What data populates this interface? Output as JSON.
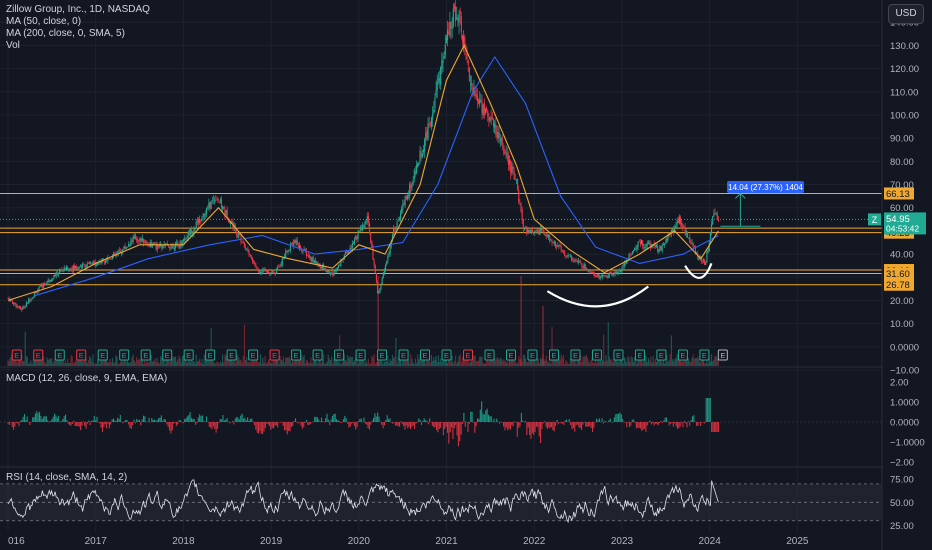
{
  "header": {
    "title": "Zillow Group, Inc., 1D, NASDAQ",
    "indicators": [
      "MA (50, close, 0)",
      "MA (200, close, 0, SMA, 5)",
      "Vol"
    ],
    "currency": "USD"
  },
  "chart_data": [
    {
      "type": "candlestick",
      "title": "Zillow Group, Inc., 1D, NASDAQ",
      "y_ticks": [
        "140.00",
        "130.00",
        "120.00",
        "110.00",
        "100.00",
        "90.00",
        "80.00",
        "70.00",
        "60.00",
        "50.00",
        "40.00",
        "30.00",
        "20.00",
        "10.00",
        "0.0000",
        "−10.00"
      ],
      "y_range": [
        -10,
        147
      ],
      "x_ticks": [
        "016",
        "2017",
        "2018",
        "2019",
        "2020",
        "2021",
        "2022",
        "2023",
        "2024",
        "2025"
      ],
      "x_range": [
        2016.0,
        2025.6
      ],
      "price_path": [
        {
          "x": 2016.0,
          "y": 21
        },
        {
          "x": 2016.15,
          "y": 16
        },
        {
          "x": 2016.35,
          "y": 25
        },
        {
          "x": 2016.6,
          "y": 33
        },
        {
          "x": 2016.85,
          "y": 35
        },
        {
          "x": 2017.0,
          "y": 36
        },
        {
          "x": 2017.25,
          "y": 40
        },
        {
          "x": 2017.45,
          "y": 47
        },
        {
          "x": 2017.7,
          "y": 43
        },
        {
          "x": 2017.95,
          "y": 44
        },
        {
          "x": 2018.15,
          "y": 53
        },
        {
          "x": 2018.37,
          "y": 65
        },
        {
          "x": 2018.6,
          "y": 50
        },
        {
          "x": 2018.85,
          "y": 33
        },
        {
          "x": 2019.05,
          "y": 32
        },
        {
          "x": 2019.25,
          "y": 46
        },
        {
          "x": 2019.45,
          "y": 38
        },
        {
          "x": 2019.7,
          "y": 31
        },
        {
          "x": 2019.95,
          "y": 46
        },
        {
          "x": 2020.1,
          "y": 55
        },
        {
          "x": 2020.22,
          "y": 22
        },
        {
          "x": 2020.4,
          "y": 50
        },
        {
          "x": 2020.6,
          "y": 70
        },
        {
          "x": 2020.8,
          "y": 95
        },
        {
          "x": 2021.0,
          "y": 132
        },
        {
          "x": 2021.12,
          "y": 147
        },
        {
          "x": 2021.3,
          "y": 110
        },
        {
          "x": 2021.55,
          "y": 95
        },
        {
          "x": 2021.8,
          "y": 70
        },
        {
          "x": 2021.88,
          "y": 50
        },
        {
          "x": 2022.1,
          "y": 50
        },
        {
          "x": 2022.35,
          "y": 40
        },
        {
          "x": 2022.6,
          "y": 34
        },
        {
          "x": 2022.75,
          "y": 30
        },
        {
          "x": 2022.95,
          "y": 32
        },
        {
          "x": 2023.2,
          "y": 45
        },
        {
          "x": 2023.45,
          "y": 42
        },
        {
          "x": 2023.65,
          "y": 55
        },
        {
          "x": 2023.85,
          "y": 40
        },
        {
          "x": 2023.95,
          "y": 36
        },
        {
          "x": 2024.05,
          "y": 58
        },
        {
          "x": 2024.1,
          "y": 55
        }
      ],
      "ma50_path": [
        {
          "x": 2016.0,
          "y": 20
        },
        {
          "x": 2016.5,
          "y": 26
        },
        {
          "x": 2017.0,
          "y": 36
        },
        {
          "x": 2017.5,
          "y": 44
        },
        {
          "x": 2018.0,
          "y": 44
        },
        {
          "x": 2018.4,
          "y": 60
        },
        {
          "x": 2018.8,
          "y": 42
        },
        {
          "x": 2019.2,
          "y": 38
        },
        {
          "x": 2019.7,
          "y": 34
        },
        {
          "x": 2020.0,
          "y": 44
        },
        {
          "x": 2020.3,
          "y": 40
        },
        {
          "x": 2020.7,
          "y": 70
        },
        {
          "x": 2021.0,
          "y": 115
        },
        {
          "x": 2021.2,
          "y": 130
        },
        {
          "x": 2021.5,
          "y": 105
        },
        {
          "x": 2021.8,
          "y": 78
        },
        {
          "x": 2022.0,
          "y": 55
        },
        {
          "x": 2022.4,
          "y": 42
        },
        {
          "x": 2022.8,
          "y": 32
        },
        {
          "x": 2023.2,
          "y": 40
        },
        {
          "x": 2023.6,
          "y": 50
        },
        {
          "x": 2023.9,
          "y": 38
        },
        {
          "x": 2024.1,
          "y": 50
        }
      ],
      "ma200_path": [
        {
          "x": 2016.3,
          "y": 22
        },
        {
          "x": 2017.0,
          "y": 30
        },
        {
          "x": 2017.6,
          "y": 38
        },
        {
          "x": 2018.3,
          "y": 44
        },
        {
          "x": 2018.9,
          "y": 48
        },
        {
          "x": 2019.5,
          "y": 40
        },
        {
          "x": 2020.0,
          "y": 42
        },
        {
          "x": 2020.5,
          "y": 45
        },
        {
          "x": 2020.9,
          "y": 70
        },
        {
          "x": 2021.3,
          "y": 110
        },
        {
          "x": 2021.55,
          "y": 125
        },
        {
          "x": 2021.9,
          "y": 105
        },
        {
          "x": 2022.3,
          "y": 65
        },
        {
          "x": 2022.7,
          "y": 43
        },
        {
          "x": 2023.2,
          "y": 36
        },
        {
          "x": 2023.7,
          "y": 40
        },
        {
          "x": 2024.1,
          "y": 48
        }
      ],
      "horizontal_levels": [
        {
          "value": 66.13,
          "label": "66.13",
          "color": "#f0a830"
        },
        {
          "value": 51.18,
          "label": "51.18",
          "color": "#f0a830"
        },
        {
          "value": 49.23,
          "label": "49.23",
          "color": "#f0a830"
        },
        {
          "value": 33.12,
          "label": "33.12",
          "color": "#f0a830"
        },
        {
          "value": 31.6,
          "label": "31.60",
          "color": "#f0a830"
        },
        {
          "value": 26.78,
          "label": "26.78",
          "color": "#f0a830"
        }
      ],
      "last_price": {
        "value": 54.95,
        "label": "54.95",
        "countdown": "04:53:42",
        "symbol": "Z",
        "color": "#22ab94"
      },
      "measure_label": "14.04 (27.37%) 1404",
      "earnings_marker": "E",
      "colors": {
        "up": "#22ab94",
        "down": "#f23645",
        "ma50": "#f0a830",
        "ma200": "#2962ff",
        "arc": "#ffffff"
      }
    },
    {
      "type": "histogram",
      "title": "MACD (12, 26, close, 9, EMA, EMA)",
      "y_ticks": [
        "2.00",
        "1.0000",
        "0.0000",
        "−1.0000",
        "−2.00"
      ],
      "y_range": [
        -2.2,
        2.5
      ]
    },
    {
      "type": "line",
      "title": "RSI (14, close, SMA, 14, 2)",
      "y_ticks": [
        "75.00",
        "50.00",
        "25.00"
      ],
      "y_range": [
        20,
        85
      ],
      "band": [
        30,
        70
      ]
    }
  ]
}
